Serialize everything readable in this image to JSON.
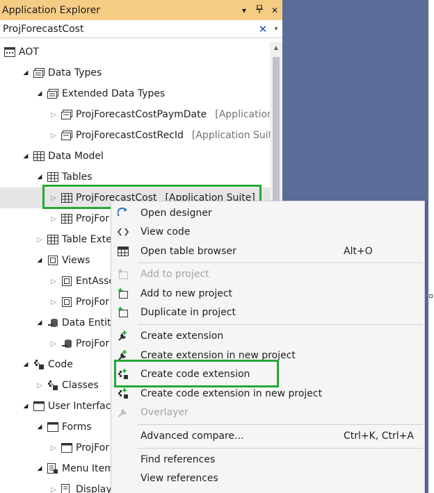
{
  "window": {
    "title": "Application Explorer",
    "buttons": {
      "dropdown": "▾",
      "pin": "⊥",
      "close": "✕"
    }
  },
  "search": {
    "value": "ProjForecastCost",
    "clear": "✕",
    "dropdown": "▾"
  },
  "tree": {
    "aot": "AOT",
    "data_types": "Data Types",
    "extended_data_types": "Extended Data Types",
    "edt_paym_date": {
      "label": "ProjForecastCostPaymDate",
      "suffix": "[Application"
    },
    "edt_rec_id": {
      "label": "ProjForecastCostRecId",
      "suffix": "[Application Suit"
    },
    "data_model": "Data Model",
    "tables": "Tables",
    "table_selected": {
      "label": "ProjForecastCost",
      "suffix": "[Application Suite]"
    },
    "table_second": "ProjFor",
    "table_extensions": "Table Exte",
    "views": "Views",
    "view_ent": "EntAsse",
    "view_proj": "ProjFor",
    "data_entities": "Data Entit",
    "entity_proj": "ProjFor",
    "code": "Code",
    "classes": "Classes",
    "user_interface": "User Interface",
    "forms": "Forms",
    "form_proj": "ProjFor",
    "menu_items": "Menu Item",
    "display": "Display"
  },
  "context_menu": {
    "open_designer": "Open designer",
    "view_code": "View code",
    "open_table_browser": "Open table browser",
    "open_table_browser_shortcut": "Alt+O",
    "add_to_project": "Add to project",
    "add_to_new_project": "Add to new project",
    "duplicate_in_project": "Duplicate in project",
    "create_extension": "Create extension",
    "create_extension_new_project": "Create extension in new project",
    "create_code_extension": "Create code extension",
    "create_code_extension_new_project": "Create code extension in new project",
    "overlayer": "Overlayer",
    "advanced_compare": "Advanced compare...",
    "advanced_compare_shortcut": "Ctrl+K, Ctrl+A",
    "find_references": "Find references",
    "view_references": "View references"
  },
  "colors": {
    "title_bar": "#f5cc84",
    "background_right": "#5c6b97",
    "highlight": "#22a836",
    "menu_background": "#f5f5f5"
  }
}
